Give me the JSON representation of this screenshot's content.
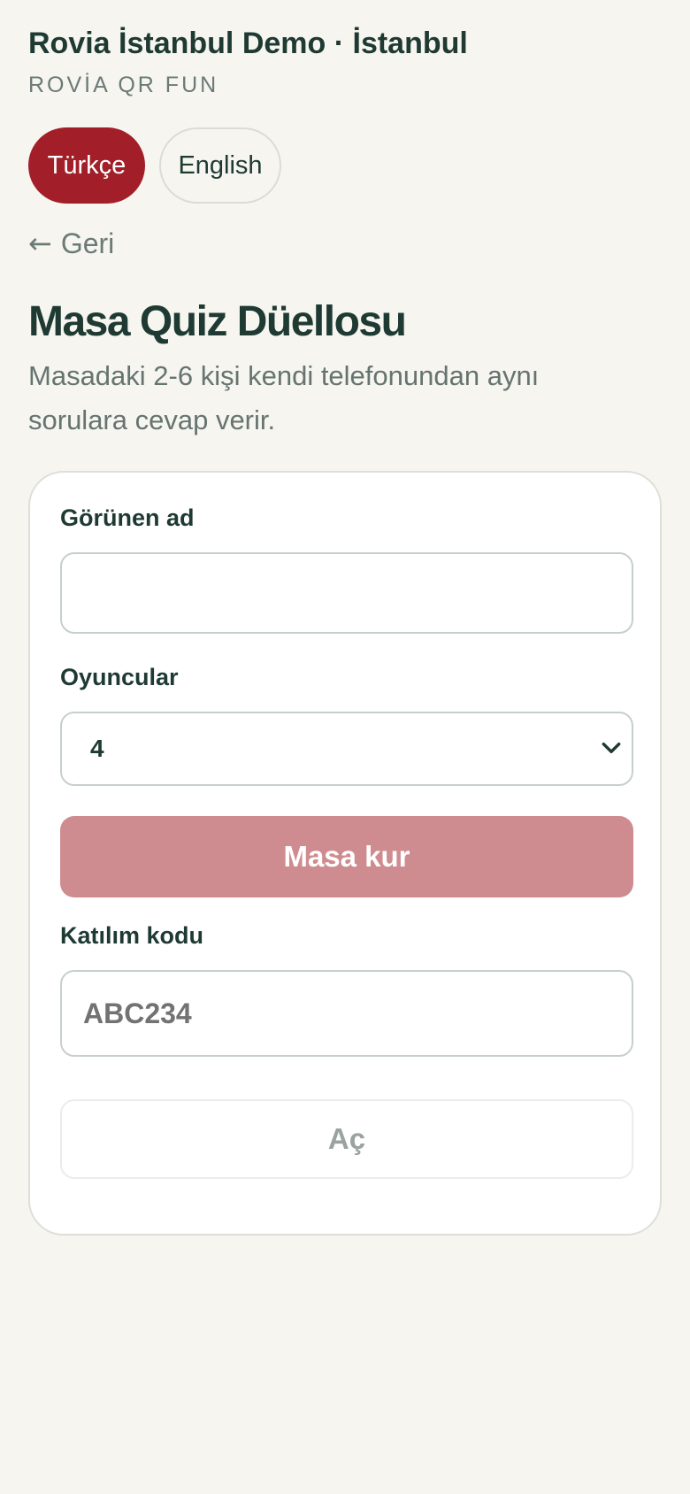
{
  "header": {
    "venue_title": "Rovia İstanbul Demo · İstanbul",
    "venue_subtitle": "ROVİA QR FUN"
  },
  "languages": [
    {
      "label": "Türkçe",
      "active": true
    },
    {
      "label": "English",
      "active": false
    }
  ],
  "back": {
    "arrow": "←",
    "label": "Geri"
  },
  "page": {
    "title": "Masa Quiz Düellosu",
    "description": "Masadaki 2-6 kişi kendi telefonundan aynı sorulara cevap verir."
  },
  "form": {
    "display_name_label": "Görünen ad",
    "display_name_value": "",
    "players_label": "Oyuncular",
    "players_value": "4",
    "create_button_label": "Masa kur",
    "join_code_label": "Katılım kodu",
    "join_code_placeholder": "ABC234",
    "open_button_label": "Aç"
  },
  "colors": {
    "background": "#f6f5f0",
    "accent": "#a21f29",
    "accent_disabled": "#cf8c90",
    "text_primary": "#1f3a33",
    "text_muted": "#6b7a76"
  },
  "icons": {
    "select_arrow": "chevron-down-icon",
    "back": "arrow-left-icon"
  }
}
